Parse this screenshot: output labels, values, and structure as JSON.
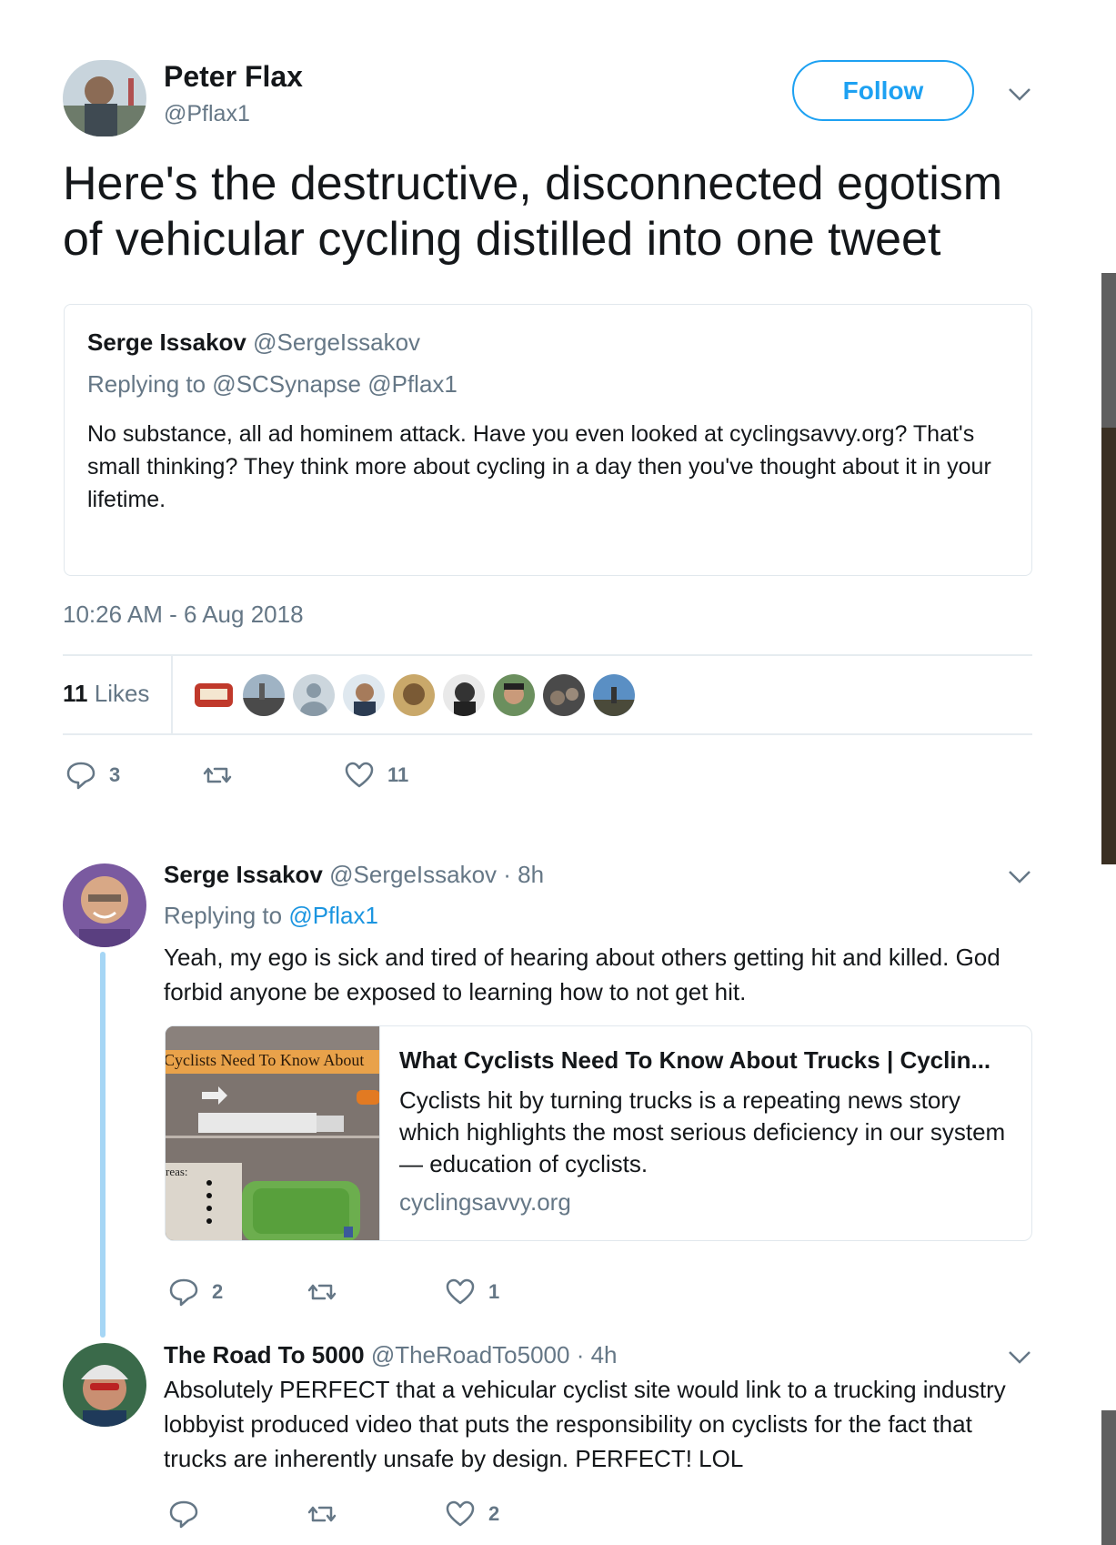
{
  "tweet": {
    "author_name": "Peter Flax",
    "author_handle": "@Pflax1",
    "follow_label": "Follow",
    "text": "Here's the destructive, disconnected egotism of vehicular cycling distilled into one tweet",
    "quoted": {
      "author_name": "Serge Issakov",
      "author_handle": "@SergeIssakov",
      "replying_to": "Replying to @SCSynapse @Pflax1",
      "text": "No substance, all ad hominem attack. Have you even looked at cyclingsavvy.org? That's small thinking?  They think more about cycling in a day then you've thought about it in your lifetime."
    },
    "timestamp": "10:26 AM - 6 Aug 2018",
    "likes_count": "11",
    "likes_label": "Likes",
    "reply_count": "3",
    "like_count": "11"
  },
  "replies": [
    {
      "author_name": "Serge Issakov",
      "author_handle": "@SergeIssakov",
      "time": "· 8h",
      "replying_prefix": "Replying to ",
      "replying_handle": "@Pflax1",
      "text": "Yeah, my ego is sick and tired of hearing about others getting hit and killed. God forbid anyone be exposed to learning how to not get hit.",
      "card": {
        "image_caption": "Cyclists Need To Know About",
        "image_label": "reas:",
        "title": "What Cyclists Need To Know About Trucks | Cyclin...",
        "description": "Cyclists hit by turning trucks is a repeating news story which highlights the most serious deficiency in our system — education of cyclists.",
        "domain": "cyclingsavvy.org"
      },
      "reply_count": "2",
      "like_count": "1"
    },
    {
      "author_name": "The Road To 5000",
      "author_handle": "@TheRoadTo5000",
      "time": "· 4h",
      "text": "Absolutely PERFECT that a vehicular cyclist site would link to a trucking industry lobbyist produced video that puts the responsibility on cyclists for the fact that trucks are inherently unsafe by design. PERFECT! LOL",
      "like_count": "2"
    }
  ],
  "colors": {
    "accent": "#1da1f2",
    "link": "#1b95e0",
    "muted": "#657786",
    "thread_line": "#a6d6f5"
  }
}
